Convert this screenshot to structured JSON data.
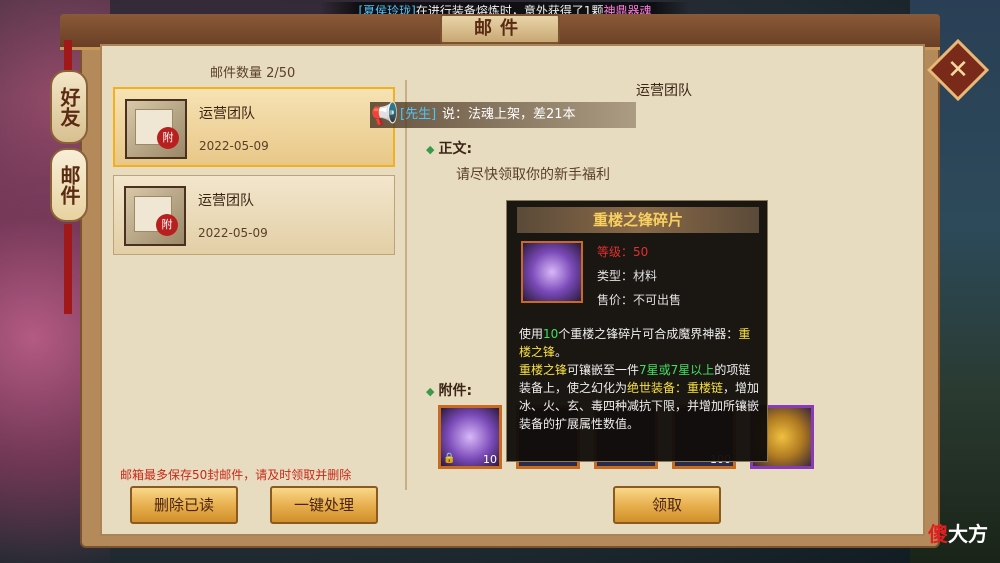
{
  "broadcast": {
    "player": "[夏侯玲珑]",
    "text": "在进行装备熔炼时，意外获得了1颗",
    "item": "神鼎器魂"
  },
  "window": {
    "title": "邮件"
  },
  "tabs": [
    {
      "label": "好友"
    },
    {
      "label": "邮件"
    }
  ],
  "mailbox": {
    "count_label": "邮件数量 2/50",
    "items": [
      {
        "sender": "运营团队",
        "date": "2022-05-09",
        "seal": "附"
      },
      {
        "sender": "运营团队",
        "date": "2022-05-09",
        "seal": "附"
      }
    ],
    "warning": "邮箱最多保存50封邮件，请及时领取并删除",
    "delete_read_label": "删除已读",
    "one_click_label": "一键处理"
  },
  "notice": {
    "tag": "[先生]",
    "message": "说：法魂上架，差21本"
  },
  "mail_detail": {
    "title": "运营团队",
    "body_label": "正文:",
    "body": "请尽快领取你的新手福利",
    "attachments_label": "附件:",
    "attachments": [
      {
        "name": "重楼之锋碎片",
        "count": "10"
      },
      {
        "name": "",
        "count": ""
      },
      {
        "name": "",
        "count": ""
      },
      {
        "name": "",
        "count": "100"
      },
      {
        "name": "",
        "count": ""
      }
    ],
    "claim_label": "领取"
  },
  "tooltip": {
    "title": "重楼之锋碎片",
    "level": "等级：50",
    "type_key": "类型：",
    "type_val": "材料",
    "price_key": "售价：",
    "price_val": "不可出售",
    "desc_1": "使用",
    "desc_num": "10",
    "desc_2": "个重楼之锋碎片可合成魔界神器：",
    "desc_item": "重楼之锋",
    "desc_3": "。",
    "desc_item2": "重楼之锋",
    "desc_4": "可镶嵌至一件",
    "desc_stars": "7星或7星以上",
    "desc_5": "的项链装备上，使之幻化为",
    "desc_rare": "绝世装备：重楼链",
    "desc_6": "，增加冰、火、玄、毒四种减抗下限，并增加所镶嵌装备的扩展属性数值。"
  },
  "watermark": {
    "red": "傻",
    "white": "大方"
  }
}
